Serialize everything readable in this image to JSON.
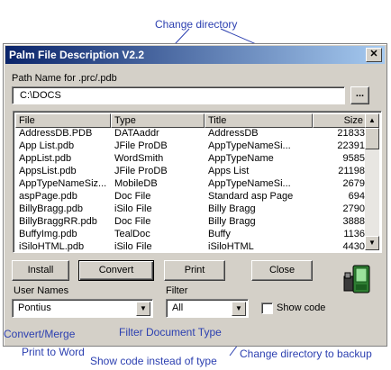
{
  "annotations": {
    "change_directory": "Change directory",
    "convert_merge": "Convert/Merge",
    "print_to_word": "Print to Word",
    "filter_document_type": "Filter Document Type",
    "show_code_instead": "Show code instead of type",
    "change_directory_backup": "Change directory to backup"
  },
  "window": {
    "title": "Palm File Description V2.2",
    "close_glyph": "✕"
  },
  "path": {
    "label": "Path Name for .prc/.pdb",
    "value": "C:\\DOCS",
    "browse_label": "..."
  },
  "list": {
    "columns": [
      "File",
      "Type",
      "Title",
      "Size"
    ],
    "rows": [
      [
        "AddressDB.PDB",
        "DATAaddr",
        "AddressDB",
        "21833"
      ],
      [
        "App List.pdb",
        "JFile ProDB",
        "AppTypeNameSi...",
        "22391"
      ],
      [
        "AppList.pdb",
        "WordSmith",
        "AppTypeName",
        "9585"
      ],
      [
        "AppsList.pdb",
        "JFile ProDB",
        "Apps List",
        "21198"
      ],
      [
        "AppTypeNameSiz...",
        "MobileDB",
        "AppTypeNameSi...",
        "2679"
      ],
      [
        "aspPage.pdb",
        "Doc File",
        "Standard asp Page",
        "694"
      ],
      [
        "BillyBragg.pdb",
        "iSilo File",
        "Billy Bragg",
        "2790"
      ],
      [
        "BillyBraggRR.pdb",
        "Doc File",
        "Billy Bragg",
        "3888"
      ],
      [
        "BuffyImg.pdb",
        "TealDoc",
        "Buffy",
        "1136"
      ],
      [
        "iSiloHTML.pdb",
        "iSilo File",
        "iSiloHTML",
        "4430"
      ]
    ]
  },
  "buttons": {
    "install": "Install",
    "convert": "Convert",
    "print": "Print",
    "close": "Close"
  },
  "user_names": {
    "label": "User Names",
    "value": "Pontius"
  },
  "filter": {
    "label": "Filter",
    "value": "All"
  },
  "show_code": {
    "label": "Show code",
    "checked": false
  },
  "icons": {
    "backup": "palm-device-icon",
    "scroll_up": "scroll-up-icon",
    "scroll_down": "scroll-down-icon",
    "dropdown": "chevron-down-icon"
  },
  "colors": {
    "annotation": "#2b3fb0",
    "titlebar_start": "#0a246a",
    "titlebar_end": "#a6caf0",
    "face": "#d4d0c8"
  }
}
